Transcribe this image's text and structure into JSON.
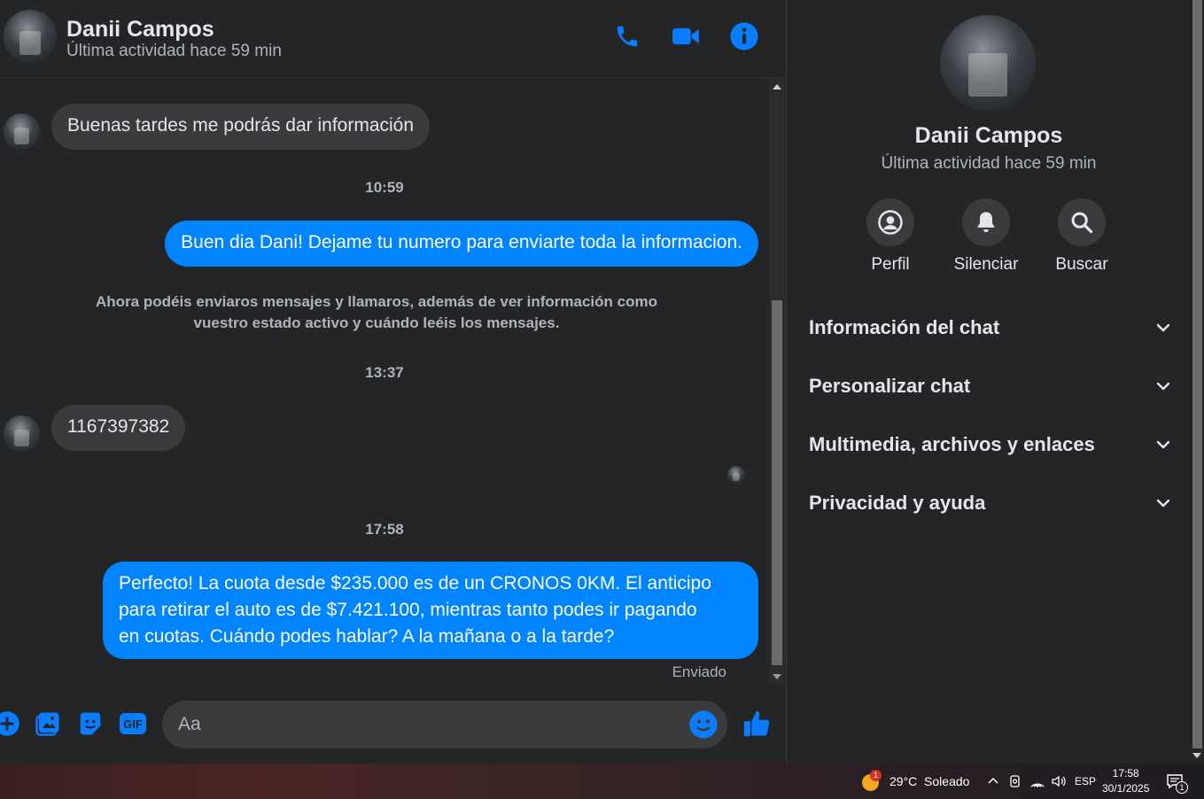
{
  "contact": {
    "name": "Danii Campos",
    "status": "Última actividad hace 59 min"
  },
  "messages": {
    "m1": "Buenas tardes me podrás dar información",
    "ts1": "10:59",
    "m2": "Buen dia Dani! Dejame tu numero para enviarte toda la informacion.",
    "system_line1": "Ahora podéis enviaros mensajes y llamaros, además de ver información como",
    "system_line2": "vuestro estado activo y cuándo leéis los mensajes.",
    "ts2": "13:37",
    "m3": "1167397382",
    "ts3": "17:58",
    "m4_line1": "Perfecto! La cuota desde $235.000 es de un CRONOS 0KM. El anticipo",
    "m4_line2": "para retirar el auto es de $7.421.100, mientras tanto podes ir pagando",
    "m4_line3": "en cuotas. Cuándo podes hablar? A la mañana o a la tarde?",
    "sent_label": "Enviado"
  },
  "composer": {
    "placeholder": "Aa",
    "gif_label": "GIF"
  },
  "info_panel": {
    "actions": [
      {
        "label": "Perfil",
        "icon": "profile-icon"
      },
      {
        "label": "Silenciar",
        "icon": "bell-icon"
      },
      {
        "label": "Buscar",
        "icon": "search-icon"
      }
    ],
    "sections": [
      "Información del chat",
      "Personalizar chat",
      "Multimedia, archivos y enlaces",
      "Privacidad y ayuda"
    ]
  },
  "taskbar": {
    "weather": "29°C  Soleado",
    "weather_badge": "1",
    "language": "ESP",
    "time": "17:58",
    "date": "30/1/2025",
    "notif_count": "1"
  },
  "colors": {
    "accent": "#0084ff",
    "background": "#242526",
    "bubble_in": "#3a3b3c"
  }
}
